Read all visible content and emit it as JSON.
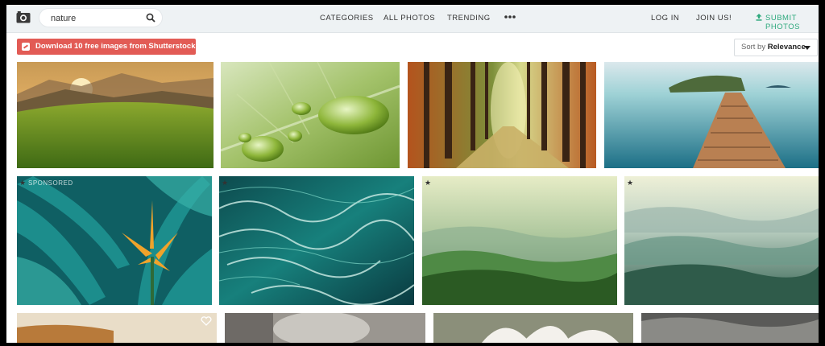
{
  "header": {
    "search_value": "nature",
    "nav": [
      "CATEGORIES",
      "ALL PHOTOS",
      "TRENDING"
    ],
    "login": "LOG IN",
    "join": "JOIN US!",
    "submit": "SUBMIT PHOTOS"
  },
  "toolbar": {
    "promo": "Download 10 free images from Shutterstock →",
    "sort_prefix": "Sort by",
    "sort_value": "Relevance"
  },
  "tiles": {
    "star": "★",
    "sponsored": "SPONSORED"
  },
  "colors": {
    "promo": "#e25b55",
    "submit": "#2ea97d",
    "header_bg": "#eef2f4"
  }
}
